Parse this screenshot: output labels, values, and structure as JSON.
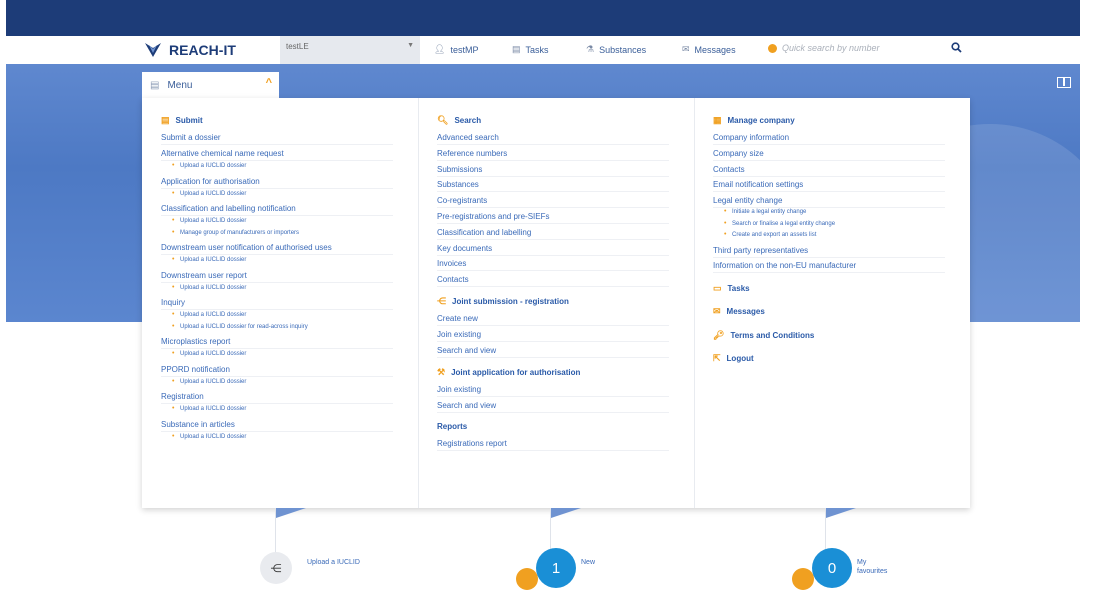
{
  "header": {
    "logo_text": "REACH-IT",
    "legal_entity": "testLE",
    "user": "testMP",
    "tasks": "Tasks",
    "substances": "Substances",
    "messages": "Messages",
    "search_placeholder": "Quick search by number"
  },
  "menu_button": {
    "label": "Menu"
  },
  "menu": {
    "submit": {
      "title": "Submit",
      "items": [
        {
          "label": "Submit a dossier",
          "subs": []
        },
        {
          "label": "Alternative chemical name request",
          "subs": [
            "Upload a IUCLID dossier"
          ]
        },
        {
          "label": "Application for authorisation",
          "subs": [
            "Upload a IUCLID dossier"
          ]
        },
        {
          "label": "Classification and labelling notification",
          "subs": [
            "Upload a IUCLID dossier",
            "Manage group of manufacturers or importers"
          ]
        },
        {
          "label": "Downstream user notification of authorised uses",
          "subs": [
            "Upload a IUCLID dossier"
          ]
        },
        {
          "label": "Downstream user report",
          "subs": [
            "Upload a IUCLID dossier"
          ]
        },
        {
          "label": "Inquiry",
          "subs": [
            "Upload a IUCLID dossier",
            "Upload a IUCLID dossier for read-across inquiry"
          ]
        },
        {
          "label": "Microplastics report",
          "subs": [
            "Upload a IUCLID dossier"
          ]
        },
        {
          "label": "PPORD notification",
          "subs": [
            "Upload a IUCLID dossier"
          ]
        },
        {
          "label": "Registration",
          "subs": [
            "Upload a IUCLID dossier"
          ]
        },
        {
          "label": "Substance in articles",
          "subs": [
            "Upload a IUCLID dossier"
          ]
        }
      ]
    },
    "search": {
      "title": "Search",
      "items": [
        "Advanced search",
        "Reference numbers",
        "Submissions",
        "Substances",
        "Co-registrants",
        "Pre-registrations and pre-SIEFs",
        "Classification and labelling",
        "Key documents",
        "Invoices",
        "Contacts"
      ]
    },
    "joint_submission": {
      "title": "Joint submission - registration",
      "items": [
        "Create new",
        "Join existing",
        "Search and view"
      ]
    },
    "joint_application": {
      "title": "Joint application for authorisation",
      "items": [
        "Join existing",
        "Search and view"
      ]
    },
    "reports": {
      "title": "Reports",
      "items": [
        "Registrations report"
      ]
    },
    "manage_company": {
      "title": "Manage company",
      "items": [
        "Company information",
        "Company size",
        "Contacts",
        "Email notification settings",
        "Legal entity change"
      ],
      "legal_subs": [
        "Initiate a legal entity change",
        "Search or finalise a legal entity change",
        "Create and export an assets list"
      ],
      "items2": [
        "Third party representatives",
        "Information on the non-EU manufacturer"
      ]
    },
    "tasks": "Tasks",
    "messages": "Messages",
    "terms": "Terms and Conditions",
    "logout": "Logout"
  },
  "bottom": {
    "upload_label": "Upload a IUCLID",
    "new_count": "1",
    "new_label": "New",
    "fav_count": "0",
    "fav_label": "My favourites"
  },
  "colors": {
    "navy": "#1d3c78",
    "accent": "#f0a020",
    "band": "#5b86cf",
    "link": "#3a6ab8"
  }
}
